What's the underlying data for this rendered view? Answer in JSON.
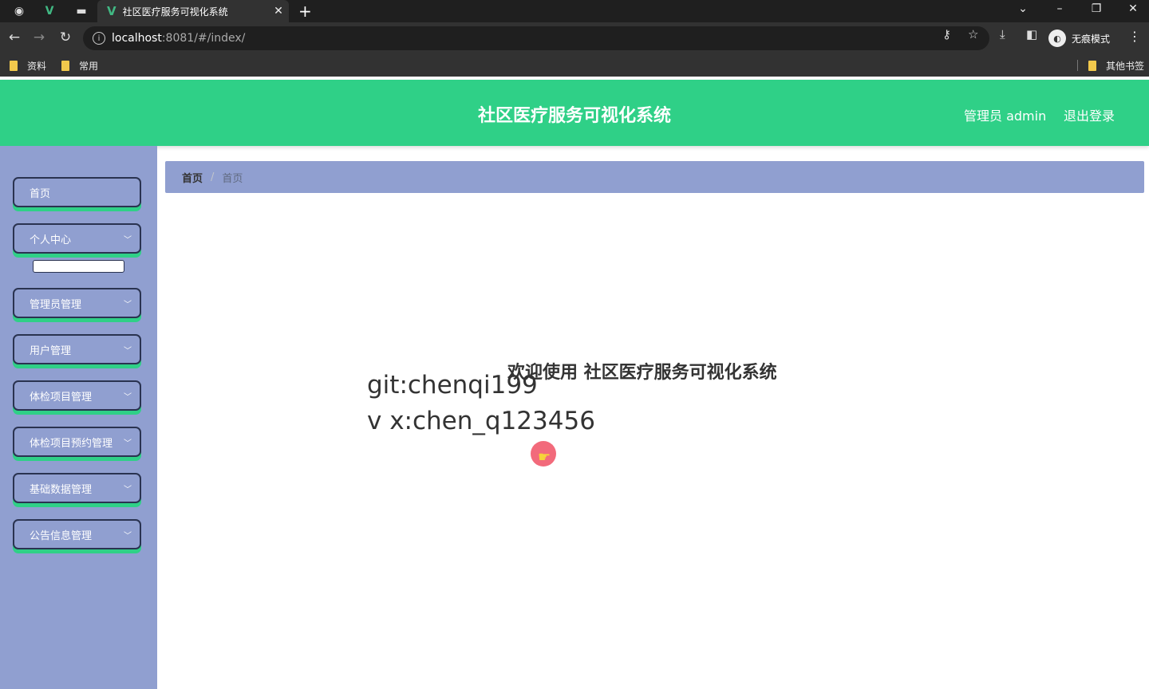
{
  "browser": {
    "tab_title": "社区医疗服务可视化系统",
    "url_host": "localhost",
    "url_rest": ":8081/#/index/",
    "incognito_label": "无痕模式",
    "bookmarks": [
      "资料",
      "常用"
    ],
    "other_bookmarks": "其他书签"
  },
  "header": {
    "title": "社区医疗服务可视化系统",
    "user_label": "管理员 admin",
    "logout_label": "退出登录",
    "bg_color": "#2fd087"
  },
  "sidebar": {
    "bg_color": "#909fd0",
    "items": [
      {
        "label": "首页",
        "has_submenu": false
      },
      {
        "label": "个人中心",
        "has_submenu": true
      },
      {
        "label": "管理员管理",
        "has_submenu": true
      },
      {
        "label": "用户管理",
        "has_submenu": true
      },
      {
        "label": "体检项目管理",
        "has_submenu": true
      },
      {
        "label": "体检项目预约管理",
        "has_submenu": true
      },
      {
        "label": "基础数据管理",
        "has_submenu": true
      },
      {
        "label": "公告信息管理",
        "has_submenu": true
      }
    ]
  },
  "breadcrumb": {
    "home": "首页",
    "separator": "/",
    "current": "首页"
  },
  "main": {
    "welcome_text": "欢迎使用 社区医疗服务可视化系统",
    "watermark_line1": "git:chenqi199",
    "watermark_line2": "v x:chen_q123456"
  }
}
